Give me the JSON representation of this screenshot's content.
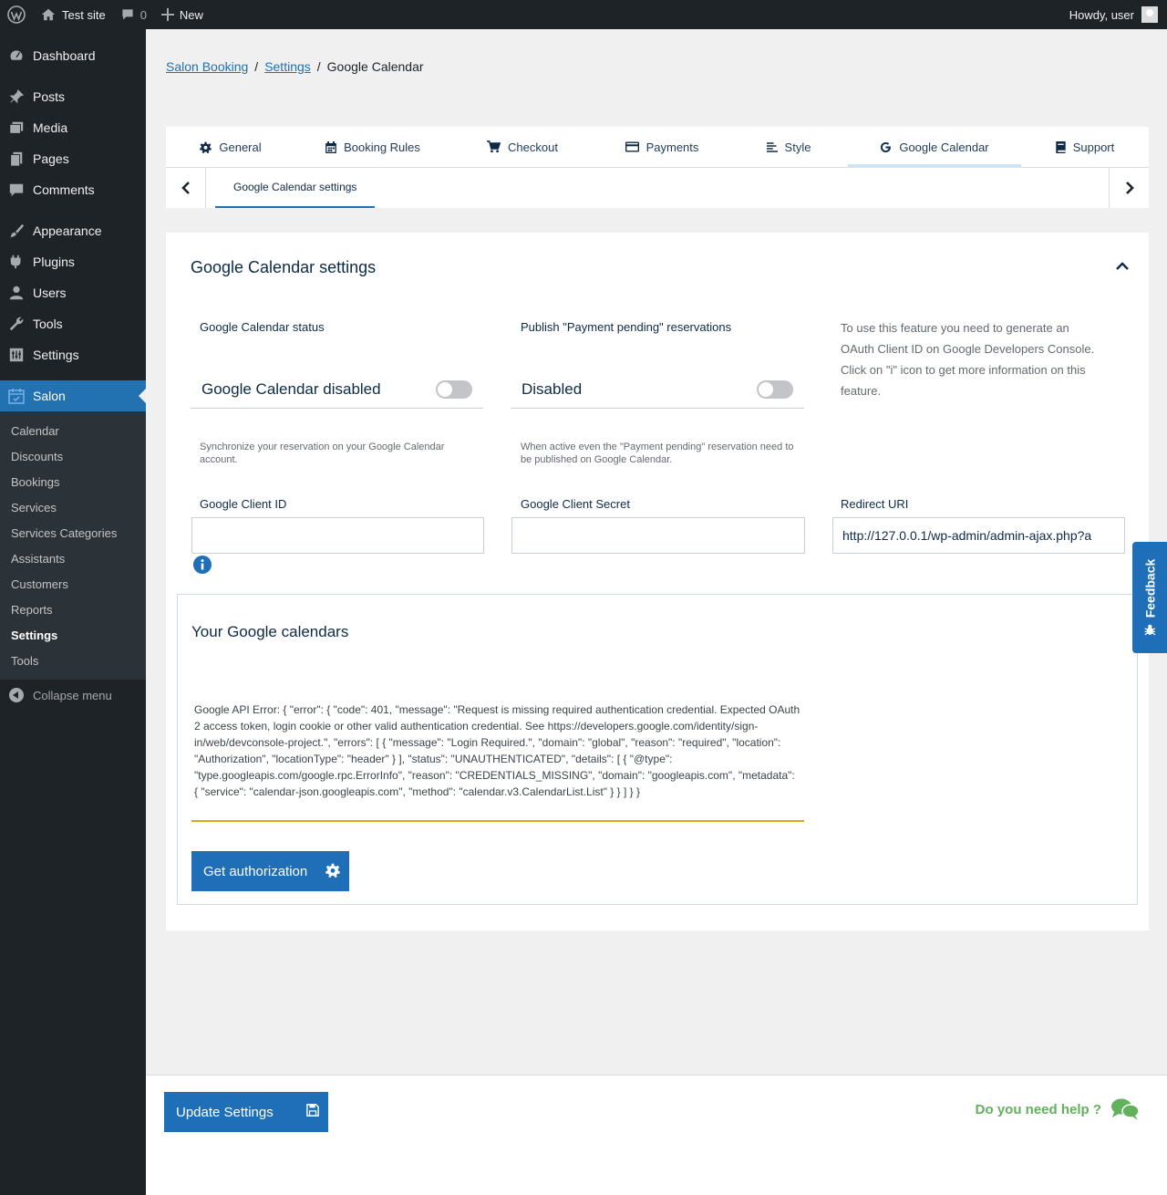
{
  "adminbar": {
    "site_name": "Test site",
    "comments_count": "0",
    "new_label": "New",
    "howdy": "Howdy, user"
  },
  "sidebar": {
    "items": [
      {
        "label": "Dashboard",
        "icon": "dashboard-icon"
      },
      {
        "label": "Posts",
        "icon": "pin-icon"
      },
      {
        "label": "Media",
        "icon": "media-icon"
      },
      {
        "label": "Pages",
        "icon": "pages-icon"
      },
      {
        "label": "Comments",
        "icon": "comment-icon"
      },
      {
        "label": "Appearance",
        "icon": "brush-icon"
      },
      {
        "label": "Plugins",
        "icon": "plugin-icon"
      },
      {
        "label": "Users",
        "icon": "user-icon"
      },
      {
        "label": "Tools",
        "icon": "wrench-icon"
      },
      {
        "label": "Settings",
        "icon": "settings-icon"
      },
      {
        "label": "Salon",
        "icon": "calendar-icon"
      }
    ],
    "submenu": [
      "Calendar",
      "Discounts",
      "Bookings",
      "Services",
      "Services Categories",
      "Assistants",
      "Customers",
      "Reports",
      "Settings",
      "Tools"
    ],
    "collapse_label": "Collapse menu"
  },
  "breadcrumb": {
    "level1": "Salon Booking",
    "level2": "Settings",
    "current": "Google Calendar",
    "sep": "/"
  },
  "tabs": [
    {
      "label": "General",
      "icon": "gear-icon"
    },
    {
      "label": "Booking Rules",
      "icon": "calendar-icon"
    },
    {
      "label": "Checkout",
      "icon": "cart-icon"
    },
    {
      "label": "Payments",
      "icon": "credit-card-icon"
    },
    {
      "label": "Style",
      "icon": "align-left-icon"
    },
    {
      "label": "Google Calendar",
      "icon": "google-icon"
    },
    {
      "label": "Support",
      "icon": "book-icon"
    }
  ],
  "subtab": "Google Calendar settings",
  "panel": {
    "title": "Google Calendar settings",
    "status_label": "Google Calendar status",
    "status_value": "Google Calendar disabled",
    "status_help": "Synchronize your reservation on your Google Calendar account.",
    "publish_label": "Publish \"Payment pending\" reservations",
    "publish_value": "Disabled",
    "publish_help": "When active even the \"Payment pending\" reservation need to be published on Google Calendar.",
    "side_note": "To use this feature you need to generate an OAuth Client ID on Google Developers Console. Click on \"i\" icon to get more information on this feature.",
    "client_id_label": "Google Client ID",
    "client_id_value": "",
    "client_secret_label": "Google Client Secret",
    "client_secret_value": "",
    "redirect_label": "Redirect URI",
    "redirect_value": "http://127.0.0.1/wp-admin/admin-ajax.php?a",
    "calendars_title": "Your Google calendars",
    "error_text": "Google API Error: { \"error\": { \"code\": 401, \"message\": \"Request is missing required authentication credential. Expected OAuth 2 access token, login cookie or other valid authentication credential. See https://developers.google.com/identity/sign-in/web/devconsole-project.\", \"errors\": [ { \"message\": \"Login Required.\", \"domain\": \"global\", \"reason\": \"required\", \"location\": \"Authorization\", \"locationType\": \"header\" } ], \"status\": \"UNAUTHENTICATED\", \"details\": [ { \"@type\": \"type.googleapis.com/google.rpc.ErrorInfo\", \"reason\": \"CREDENTIALS_MISSING\", \"domain\": \"googleapis.com\", \"metadata\": { \"service\": \"calendar-json.googleapis.com\", \"method\": \"calendar.v3.CalendarList.List\" } } ] } }",
    "auth_button": "Get authorization"
  },
  "feedback_label": "Feedback",
  "footer": {
    "update_button": "Update Settings",
    "help_link": "Do you need help ?"
  },
  "colors": {
    "admin_dark": "#1d2327",
    "accent": "#2271b1",
    "button_blue": "#1e6fb7",
    "help_green": "#62b15d",
    "warning_underline": "#dba617"
  }
}
